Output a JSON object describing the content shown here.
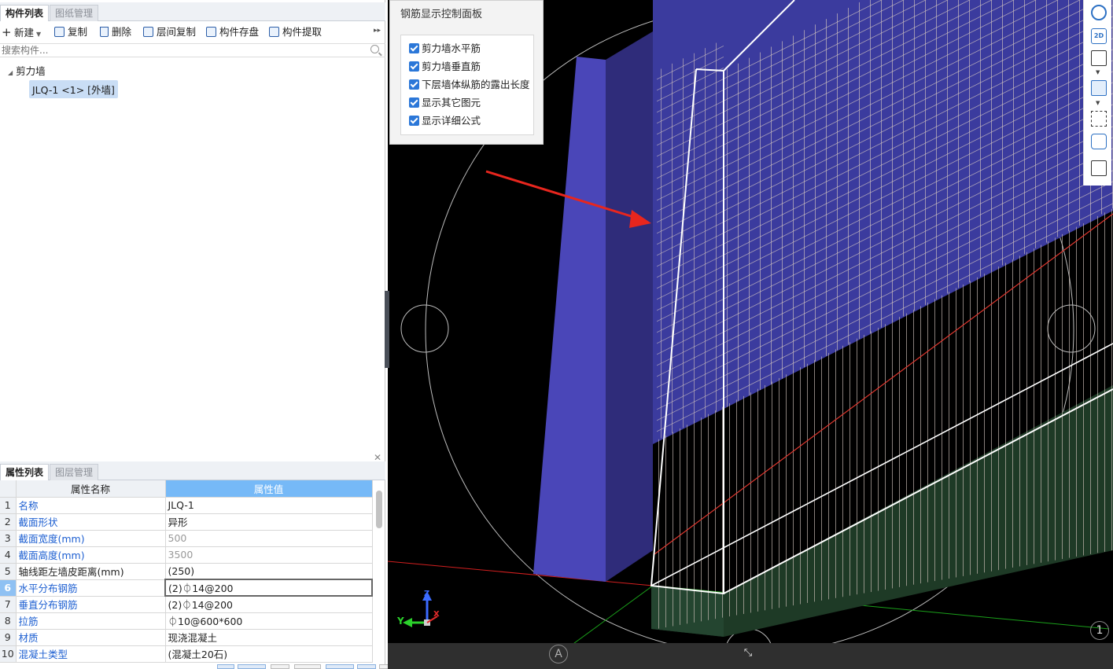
{
  "left_panel": {
    "tabs_top": [
      "构件列表",
      "图纸管理"
    ],
    "toolbar": {
      "new": "新建",
      "copy": "复制",
      "delete": "删除",
      "floor_copy": "层间复制",
      "save_component": "构件存盘",
      "extract_component": "构件提取"
    },
    "search_placeholder": "搜索构件...",
    "tree": {
      "group": "剪力墙",
      "item": "JLQ-1 <1> [外墙]"
    },
    "tabs_bottom": [
      "属性列表",
      "图层管理"
    ],
    "table": {
      "headers": [
        "属性名称",
        "属性值"
      ],
      "rows": [
        {
          "n": "1",
          "name": "名称",
          "value": "JLQ-1"
        },
        {
          "n": "2",
          "name": "截面形状",
          "value": "异形"
        },
        {
          "n": "3",
          "name": "截面宽度(mm)",
          "value": "500"
        },
        {
          "n": "4",
          "name": "截面高度(mm)",
          "value": "3500"
        },
        {
          "n": "5",
          "name": "轴线距左墙皮距离(mm)",
          "value": "(250)"
        },
        {
          "n": "6",
          "name": "水平分布钢筋",
          "value": "(2)⏀14@200"
        },
        {
          "n": "7",
          "name": "垂直分布钢筋",
          "value": "(2)⏀14@200"
        },
        {
          "n": "8",
          "name": "拉筋",
          "value": "⏀10@600*600"
        },
        {
          "n": "9",
          "name": "材质",
          "value": "现浇混凝土"
        },
        {
          "n": "10",
          "name": "混凝土类型",
          "value": "(混凝土20石)"
        }
      ]
    }
  },
  "control_panel": {
    "title": "钢筋显示控制面板",
    "options": [
      {
        "label": "剪力墙水平筋",
        "checked": true
      },
      {
        "label": "剪力墙垂直筋",
        "checked": true
      },
      {
        "label": "下层墙体纵筋的露出长度",
        "checked": true
      },
      {
        "label": "显示其它图元",
        "checked": true
      },
      {
        "label": "显示详细公式",
        "checked": true
      }
    ]
  },
  "viewport": {
    "axis_marker_a": "A",
    "axis_marker_1": "1",
    "triad": {
      "x": "X",
      "y": "Y",
      "z": "Z"
    },
    "right_tools": [
      "orbit-icon",
      "2d-icon",
      "cube-view-icon",
      "cube-solid-icon",
      "fit-frame-icon",
      "component-icon",
      "properties-doc-icon"
    ],
    "colors": {
      "wall_blue": "#3a3aa8",
      "rebar": "#d8c9c0",
      "base_green": "#1d3a25",
      "arrow_red": "#e8261e",
      "checkbox_blue": "#2b77d8",
      "header_blue": "#76b9f7"
    }
  }
}
